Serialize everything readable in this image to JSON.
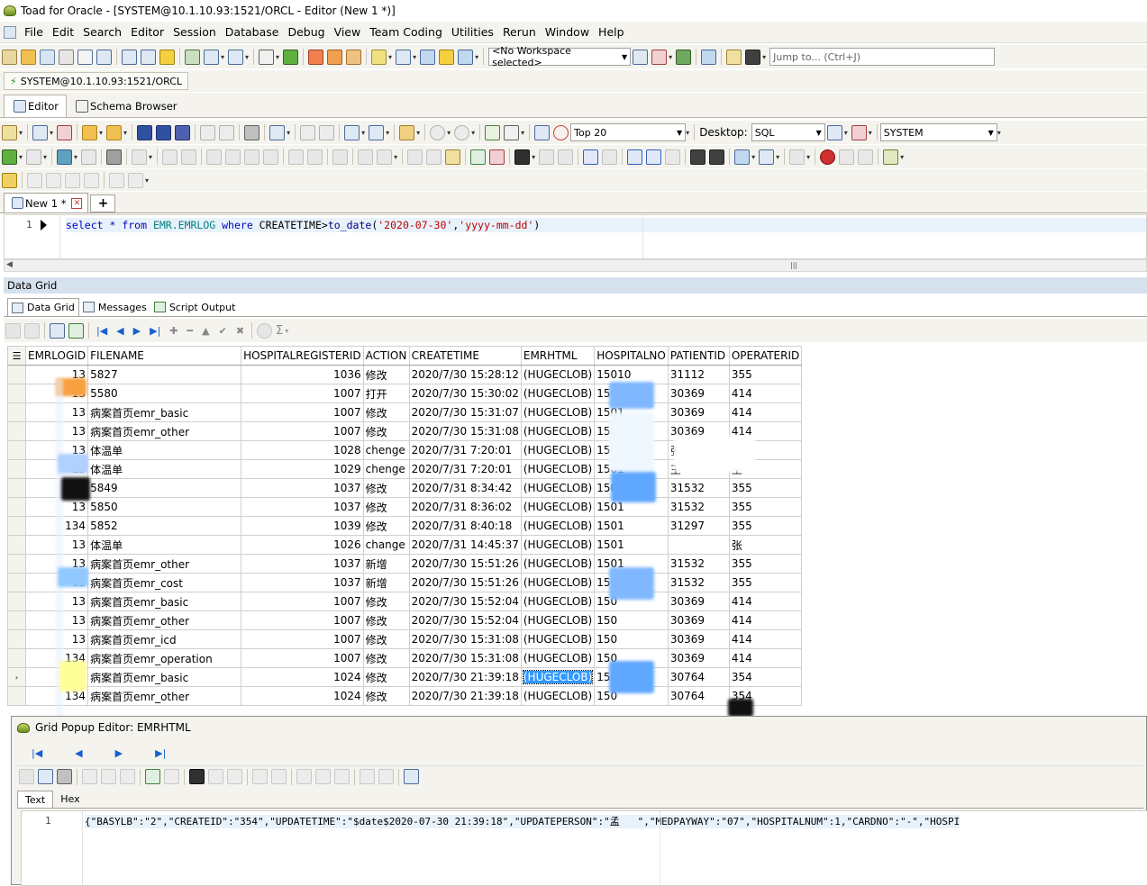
{
  "window": {
    "title": "Toad for Oracle - [SYSTEM@10.1.10.93:1521/ORCL - Editor (New 1 *)]"
  },
  "menu": [
    "File",
    "Edit",
    "Search",
    "Editor",
    "Session",
    "Database",
    "Debug",
    "View",
    "Team Coding",
    "Utilities",
    "Rerun",
    "Window",
    "Help"
  ],
  "toolbar": {
    "workspace": "<No Workspace selected>",
    "jump_placeholder": "Jump to... (Ctrl+J)"
  },
  "connection": {
    "label": "SYSTEM@10.1.10.93:1521/ORCL"
  },
  "window_tabs": [
    {
      "label": "Editor"
    },
    {
      "label": "Schema Browser"
    }
  ],
  "editor_toolbar": {
    "top_label": "Top 20",
    "desktop_label": "Desktop:",
    "desktop_value": "SQL",
    "schema_value": "SYSTEM"
  },
  "doc_tab": {
    "label": "New 1 *",
    "add": "+"
  },
  "editor": {
    "line_no": "1"
  },
  "sql": {
    "kw_select": "select",
    "star": " * ",
    "kw_from": "from",
    "table": " EMR.EMRLOG ",
    "kw_where": "where",
    "col": " CREATETIME>",
    "fn": "to_date",
    "open": "(",
    "arg1": "'2020-07-30'",
    "comma": ",",
    "arg2": "'yyyy-mm-dd'",
    "close": ")"
  },
  "panel": {
    "title": "Data Grid"
  },
  "result_tabs": [
    {
      "label": "Data Grid"
    },
    {
      "label": "Messages"
    },
    {
      "label": "Script Output"
    }
  ],
  "grid": {
    "columns": [
      "EMRLOGID",
      "FILENAME",
      "HOSPITALREGISTERID",
      "ACTION",
      "CREATETIME",
      "EMRHTML",
      "HOSPITALNO",
      "PATIENTID",
      "OPERATERID"
    ],
    "rows": [
      [
        "13",
        "5827",
        "1036",
        "修改",
        "2020/7/30 15:28:12",
        "(HUGECLOB)",
        "15010",
        "31112",
        "355"
      ],
      [
        "13",
        "5580",
        "1007",
        "打开",
        "2020/7/30 15:30:02",
        "(HUGECLOB)",
        "1501",
        "30369",
        "414"
      ],
      [
        "13",
        "病案首页emr_basic",
        "1007",
        "修改",
        "2020/7/30 15:31:07",
        "(HUGECLOB)",
        "1501",
        "30369",
        "414"
      ],
      [
        "13",
        "病案首页emr_other",
        "1007",
        "修改",
        "2020/7/30 15:31:08",
        "(HUGECLOB)",
        "1501",
        "30369",
        "414"
      ],
      [
        "13",
        "体温单",
        "1028",
        "chenge",
        "2020/7/31 7:20:01",
        "(HUGECLOB)",
        "1501",
        "张",
        "王"
      ],
      [
        "13",
        "体温单",
        "1029",
        "chenge",
        "2020/7/31 7:20:01",
        "(HUGECLOB)",
        "1501",
        "王",
        "王"
      ],
      [
        "13",
        "5849",
        "1037",
        "修改",
        "2020/7/31 8:34:42",
        "(HUGECLOB)",
        "1501",
        "31532",
        "355"
      ],
      [
        "13",
        "5850",
        "1037",
        "修改",
        "2020/7/31 8:36:02",
        "(HUGECLOB)",
        "1501",
        "31532",
        "355"
      ],
      [
        "134",
        "5852",
        "1039",
        "修改",
        "2020/7/31 8:40:18",
        "(HUGECLOB)",
        "1501",
        "31297",
        "355"
      ],
      [
        "13",
        "体温单",
        "1026",
        "change",
        "2020/7/31 14:45:37",
        "(HUGECLOB)",
        "1501",
        "",
        "张"
      ],
      [
        "13",
        "病案首页emr_other",
        "1037",
        "新增",
        "2020/7/30 15:51:26",
        "(HUGECLOB)",
        "1501",
        "31532",
        "355"
      ],
      [
        "13",
        "病案首页emr_cost",
        "1037",
        "新增",
        "2020/7/30 15:51:26",
        "(HUGECLOB)",
        "1501",
        "31532",
        "355"
      ],
      [
        "13",
        "病案首页emr_basic",
        "1007",
        "修改",
        "2020/7/30 15:52:04",
        "(HUGECLOB)",
        "150",
        "30369",
        "414"
      ],
      [
        "13",
        "病案首页emr_other",
        "1007",
        "修改",
        "2020/7/30 15:52:04",
        "(HUGECLOB)",
        "150",
        "30369",
        "414"
      ],
      [
        "13",
        "病案首页emr_icd",
        "1007",
        "修改",
        "2020/7/30 15:31:08",
        "(HUGECLOB)",
        "150",
        "30369",
        "414"
      ],
      [
        "134",
        "病案首页emr_operation",
        "1007",
        "修改",
        "2020/7/30 15:31:08",
        "(HUGECLOB)",
        "150",
        "30369",
        "414"
      ],
      [
        "134",
        "病案首页emr_basic",
        "1024",
        "修改",
        "2020/7/30 21:39:18",
        "(HUGECLOB)",
        "150",
        "30764",
        "354"
      ],
      [
        "134",
        "病案首页emr_other",
        "1024",
        "修改",
        "2020/7/30 21:39:18",
        "(HUGECLOB)",
        "150",
        "30764",
        "354"
      ]
    ],
    "current_row_marker": "›"
  },
  "popup": {
    "title": "Grid Popup Editor: EMRHTML",
    "tabs": [
      {
        "label": "Text"
      },
      {
        "label": "Hex"
      }
    ],
    "line_no": "1",
    "text": "{\"BASYLB\":\"2\",\"CREATEID\":\"354\",\"UPDATETIME\":\"$date$2020-07-30 21:39:18\",\"UPDATEPERSON\":\"孟   \",\"MEDPAYWAY\":\"07\",\"HOSPITALNUM\":1,\"CARDNO\":\"-\",\"HOSPI"
  }
}
